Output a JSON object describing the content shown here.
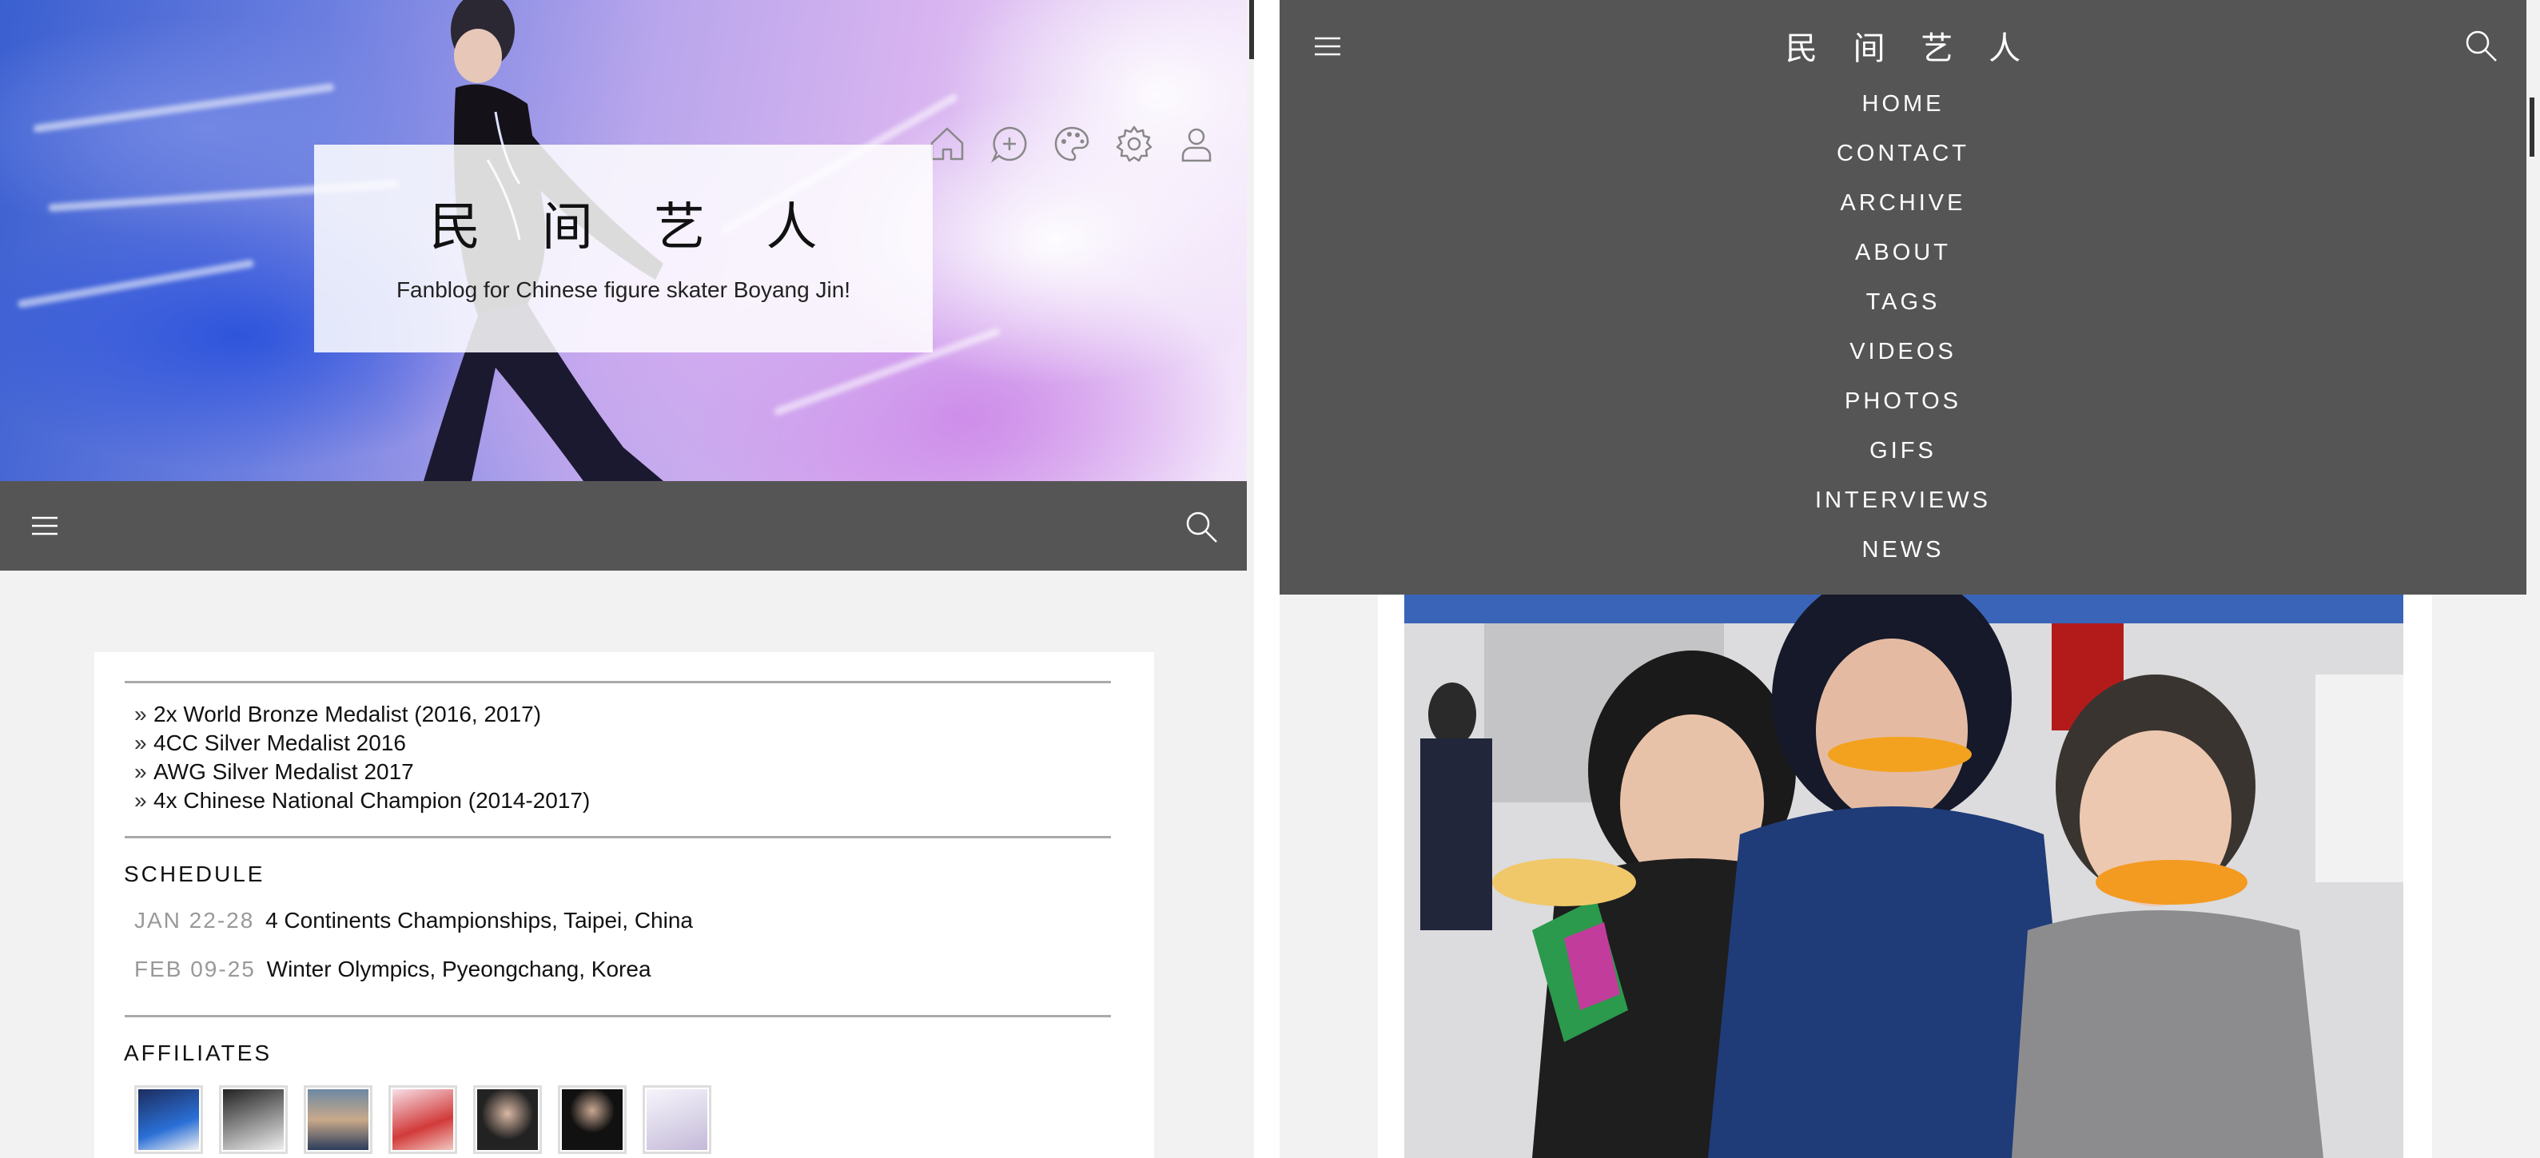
{
  "site": {
    "title": "民 间 艺 人",
    "subtitle": "Fanblog for Chinese figure skater Boyang Jin!"
  },
  "header_icons": [
    "home-icon",
    "chat-bubble-icon",
    "palette-icon",
    "gear-icon",
    "user-icon"
  ],
  "left_navbar": {
    "menu_icon": "hamburger-icon",
    "search_icon": "search-icon"
  },
  "achievements": [
    {
      "bullet": "»",
      "text": "2x World Bronze Medalist (2016, 2017)"
    },
    {
      "bullet": "»",
      "text": "4CC Silver Medalist 2016"
    },
    {
      "bullet": "»",
      "text": "AWG Silver Medalist 2017"
    },
    {
      "bullet": "»",
      "text": "4x Chinese National Champion (2014-2017)"
    }
  ],
  "schedule": {
    "heading": "SCHEDULE",
    "items": [
      {
        "date": "JAN 22-28",
        "event": "4 Continents Championships, Taipei, China"
      },
      {
        "date": "FEB 09-25",
        "event": "Winter Olympics, Pyeongchang, Korea"
      }
    ]
  },
  "affiliates": {
    "heading": "AFFILIATES",
    "thumbs": [
      {
        "name": "affiliate-1",
        "color": "#2a6fd6"
      },
      {
        "name": "affiliate-2",
        "color": "#555555"
      },
      {
        "name": "affiliate-3",
        "color": "#9a8c80"
      },
      {
        "name": "affiliate-4",
        "color": "#d23a3a"
      },
      {
        "name": "affiliate-5",
        "color": "#222222"
      },
      {
        "name": "affiliate-6",
        "color": "#111111"
      },
      {
        "name": "affiliate-7",
        "color": "#e8e4f0"
      }
    ]
  },
  "menu": {
    "title": "民 间 艺 人",
    "items": [
      "HOME",
      "CONTACT",
      "ARCHIVE",
      "ABOUT",
      "TAGS",
      "VIDEOS",
      "PHOTOS",
      "GIFS",
      "INTERVIEWS",
      "NEWS"
    ]
  },
  "colors": {
    "navbar": "#555555",
    "background": "#f2f2f2",
    "card": "#ffffff"
  }
}
